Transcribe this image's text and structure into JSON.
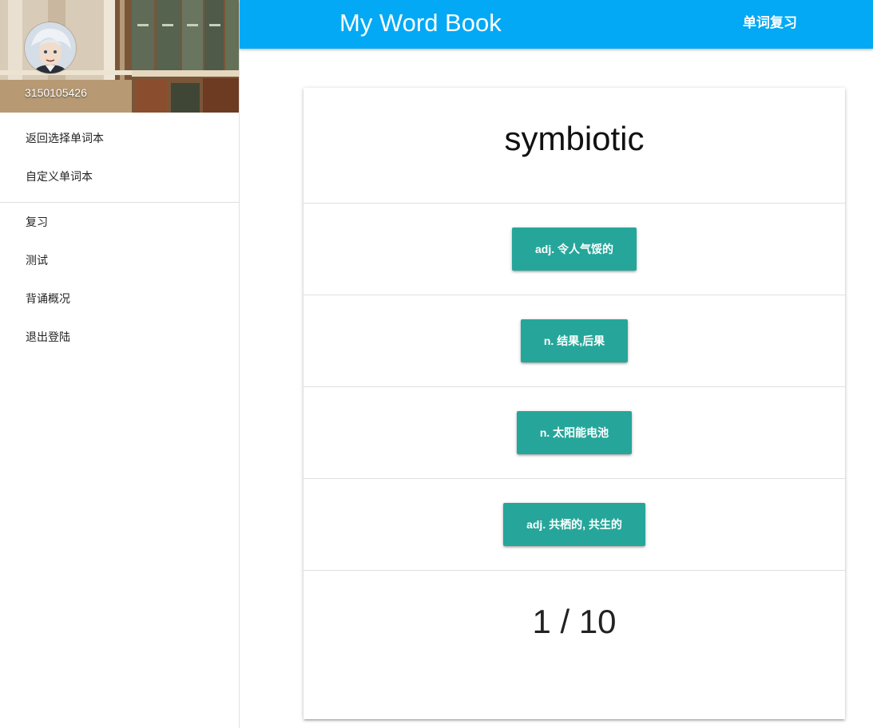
{
  "sidebar": {
    "user_id": "3150105426",
    "menu_primary": [
      {
        "label": "返回选择单词本"
      },
      {
        "label": "自定义单词本"
      }
    ],
    "menu_secondary": [
      {
        "label": "复习"
      },
      {
        "label": "测试"
      },
      {
        "label": "背诵概况"
      },
      {
        "label": "退出登陆"
      }
    ]
  },
  "header": {
    "brand": "My Word Book",
    "nav_link": "单词复习"
  },
  "quiz": {
    "word": "symbiotic",
    "options": [
      {
        "label": "adj. 令人气馁的"
      },
      {
        "label": "n. 结果,后果"
      },
      {
        "label": "n. 太阳能电池"
      },
      {
        "label": "adj. 共栖的, 共生的"
      }
    ],
    "progress": "1 / 10"
  },
  "colors": {
    "header_bg": "#03a9f4",
    "option_button_bg": "#26a69a"
  }
}
